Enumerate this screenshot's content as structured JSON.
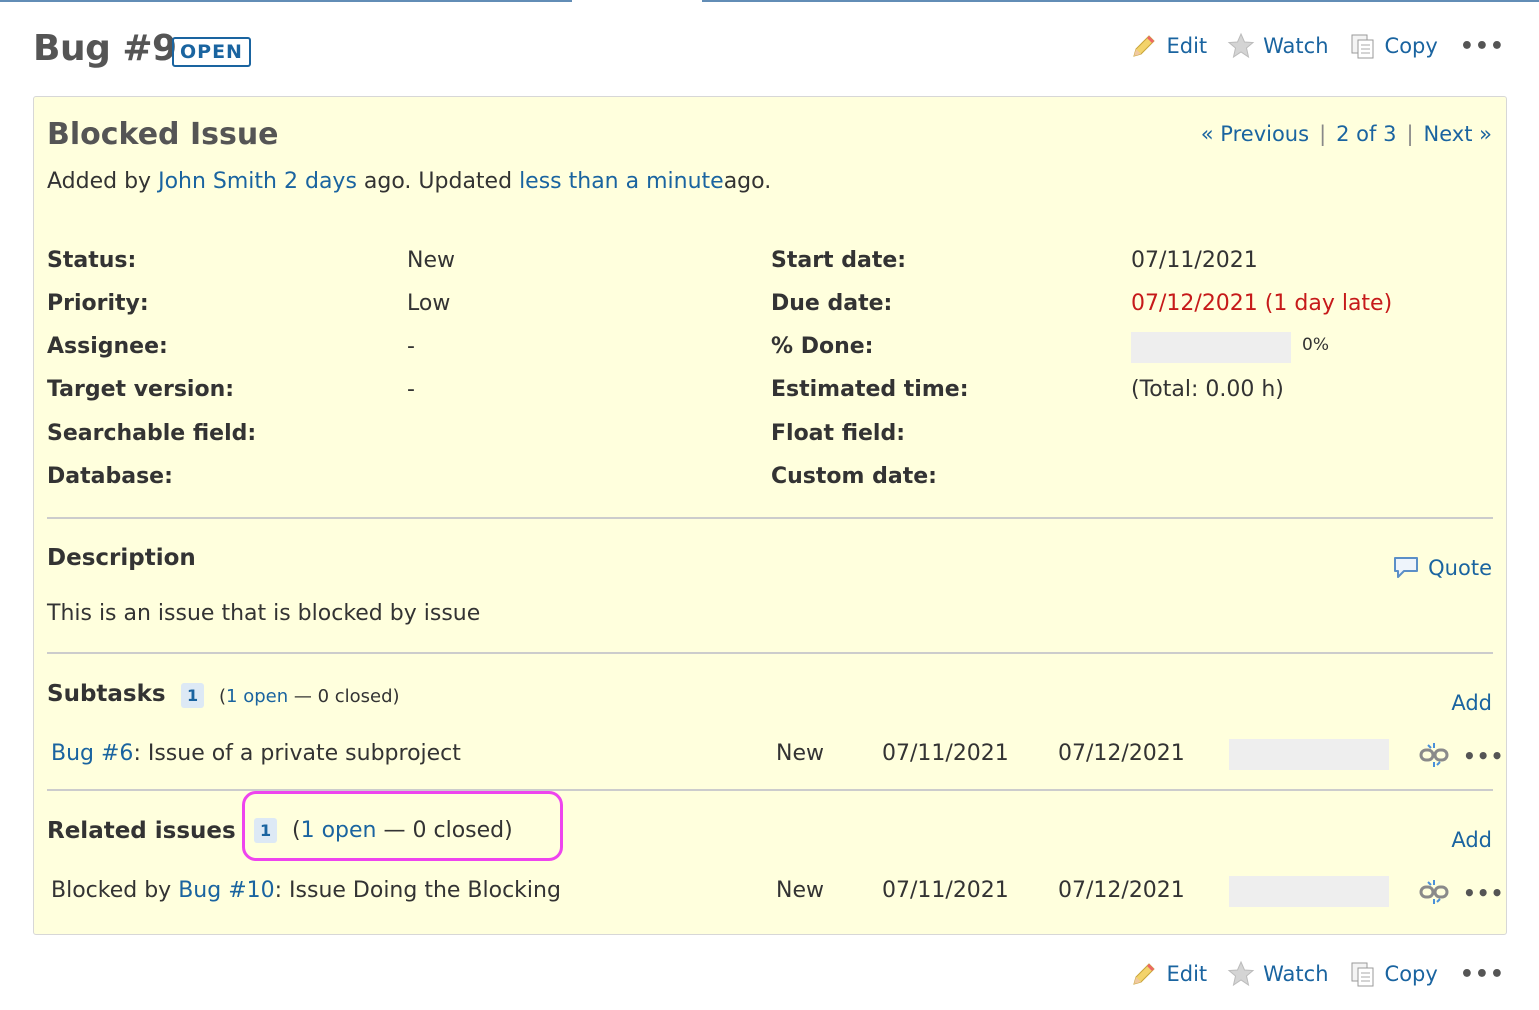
{
  "header": {
    "title": "Bug #9",
    "status_badge": "OPEN",
    "actions": {
      "edit": "Edit",
      "watch": "Watch",
      "copy": "Copy",
      "more": "•••"
    }
  },
  "issue": {
    "subject": "Blocked Issue",
    "nav": {
      "previous": "« Previous",
      "position": "2 of 3",
      "next": "Next »",
      "separator": "|"
    },
    "author_line": {
      "added_by": "Added by",
      "author": "John Smith",
      "added_ago": "2 days",
      "ago_updated": "ago. Updated",
      "updated_ago": "less than a minute",
      "ago_end": "ago."
    },
    "attributes": {
      "status": {
        "label": "Status:",
        "value": "New"
      },
      "priority": {
        "label": "Priority:",
        "value": "Low"
      },
      "assignee": {
        "label": "Assignee:",
        "value": "-"
      },
      "target_version": {
        "label": "Target version:",
        "value": "-"
      },
      "searchable_field": {
        "label": "Searchable field:",
        "value": ""
      },
      "database": {
        "label": "Database:",
        "value": ""
      },
      "start_date": {
        "label": "Start date:",
        "value": "07/11/2021"
      },
      "due_date": {
        "label": "Due date:",
        "value": "07/12/2021 (1 day late)"
      },
      "done": {
        "label": "% Done:",
        "value": "0%",
        "progress": 0
      },
      "estimated_time": {
        "label": "Estimated time:",
        "value": "(Total: 0.00 h)"
      },
      "float_field": {
        "label": "Float field:",
        "value": ""
      },
      "custom_date": {
        "label": "Custom date:",
        "value": ""
      }
    },
    "description": {
      "title": "Description",
      "quote": "Quote",
      "text": "This is an issue that is blocked by issue"
    },
    "subtasks": {
      "title": "Subtasks",
      "count": "1",
      "open_paren": "(",
      "open_link": "1 open",
      "closed_rest": "— 0 closed)",
      "add": "Add",
      "rows": [
        {
          "link": "Bug #6",
          "subject": ": Issue of a private subproject",
          "status": "New",
          "start": "07/11/2021",
          "due": "07/12/2021",
          "progress": 0,
          "more": "•••"
        }
      ]
    },
    "relations": {
      "title": "Related issues",
      "count": "1",
      "open_paren": "(",
      "open_link": "1 open",
      "closed_rest": "— 0 closed)",
      "add": "Add",
      "rows": [
        {
          "prefix": "Blocked by",
          "link": "Bug #10",
          "subject": ": Issue Doing the Blocking",
          "status": "New",
          "start": "07/11/2021",
          "due": "07/12/2021",
          "progress": 0,
          "more": "•••"
        }
      ]
    }
  },
  "colors": {
    "link": "#1a64a0",
    "late": "#c61a1a",
    "box_bg": "#ffffdd",
    "highlight": "#ee44ee"
  }
}
